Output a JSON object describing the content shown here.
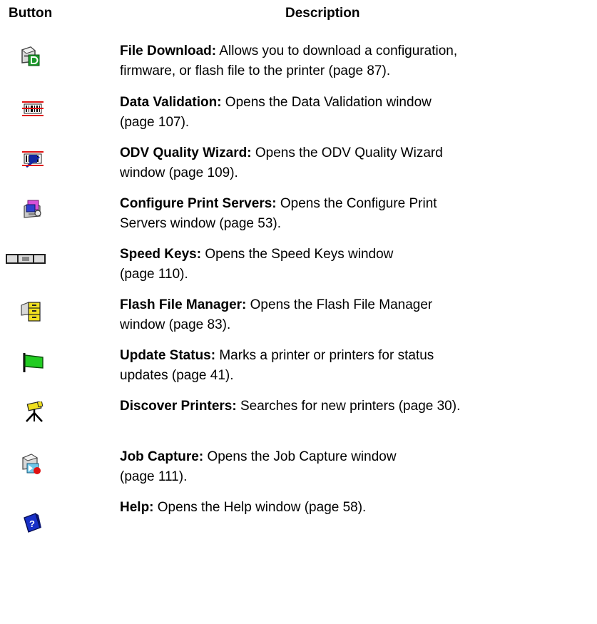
{
  "headers": {
    "button": "Button",
    "description": "Description"
  },
  "rows": [
    {
      "icon": "file-download-icon",
      "title": "File Download:",
      "line1": " Allows you to download a configuration,",
      "line2": "firmware, or flash file to the printer (page 87)."
    },
    {
      "icon": "data-validation-icon",
      "title": "Data Validation:",
      "line1": " Opens the Data Validation window",
      "line2": "(page 107)."
    },
    {
      "icon": "odv-quality-wizard-icon",
      "title": "ODV Quality Wizard:",
      "line1": " Opens the ODV Quality Wizard",
      "line2": "window (page 109)."
    },
    {
      "icon": "configure-print-servers-icon",
      "title": "Configure Print Servers:",
      "line1": " Opens the Configure Print",
      "line2": "Servers window (page 53)."
    },
    {
      "icon": "speed-keys-icon",
      "title": "Speed Keys:",
      "line1": " Opens the Speed Keys window",
      "line2": "(page 110)."
    },
    {
      "icon": "flash-file-manager-icon",
      "title": "Flash File Manager:",
      "line1": " Opens the Flash File Manager",
      "line2": "window (page 83)."
    },
    {
      "icon": "update-status-icon",
      "title": "Update Status:",
      "line1": " Marks a printer or printers for status",
      "line2": "updates (page 41)."
    },
    {
      "icon": "discover-printers-icon",
      "title": "Discover Printers:",
      "line1": " Searches for new printers (page 30).",
      "line2": ""
    },
    {
      "icon": "job-capture-icon",
      "title": "Job Capture:",
      "line1": " Opens the Job Capture window",
      "line2": "(page 111)."
    },
    {
      "icon": "help-icon",
      "title": "Help:",
      "line1": " Opens the Help window (page 58).",
      "line2": ""
    }
  ]
}
